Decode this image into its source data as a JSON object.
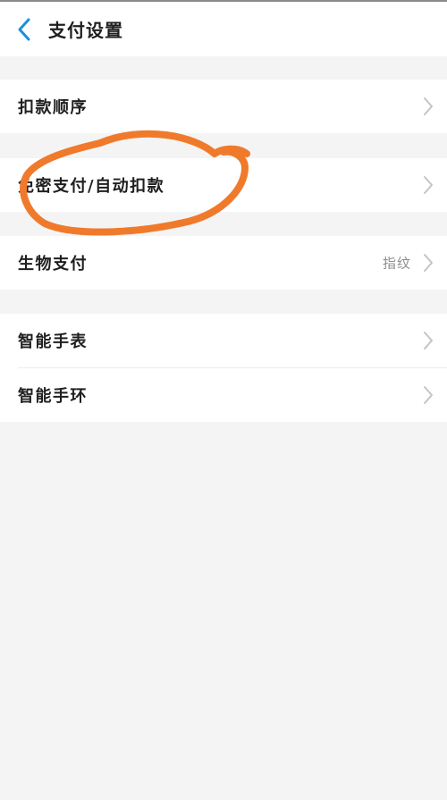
{
  "header": {
    "title": "支付设置",
    "back_icon": "chevron-left-icon",
    "accent_color": "#1a8fe0"
  },
  "groups": [
    {
      "items": [
        {
          "label": "扣款顺序",
          "value": ""
        }
      ]
    },
    {
      "items": [
        {
          "label": "免密支付/自动扣款",
          "value": ""
        }
      ]
    },
    {
      "items": [
        {
          "label": "生物支付",
          "value": "指纹"
        }
      ]
    },
    {
      "items": [
        {
          "label": "智能手表",
          "value": ""
        },
        {
          "label": "智能手环",
          "value": ""
        }
      ]
    }
  ],
  "annotation": {
    "type": "hand-drawn-circle",
    "color": "#f07a2c"
  }
}
